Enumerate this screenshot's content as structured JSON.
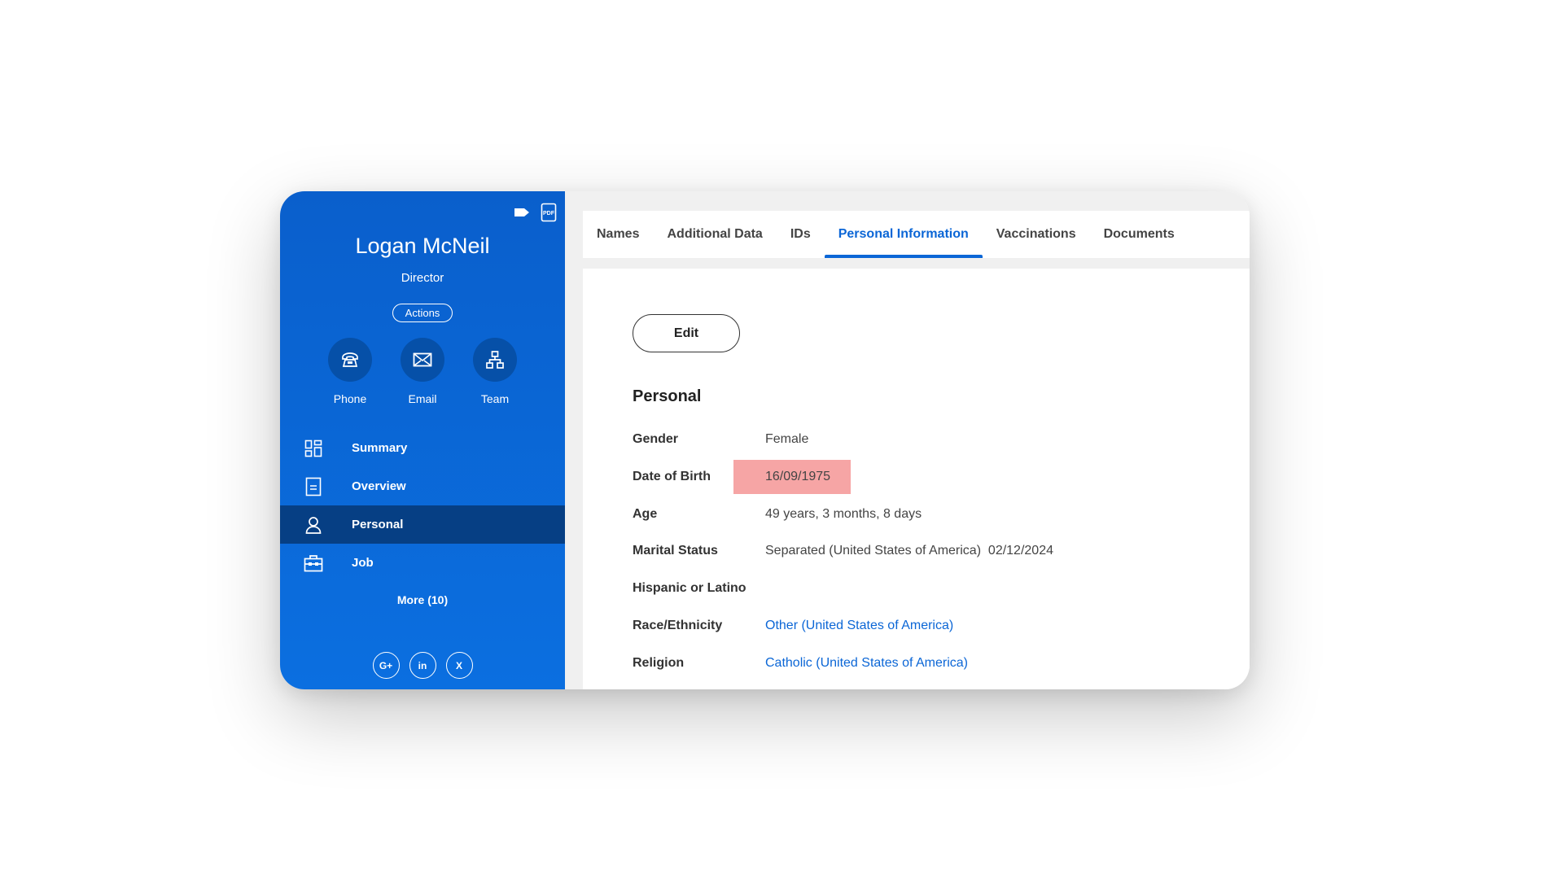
{
  "profile": {
    "name": "Logan McNeil",
    "title": "Director",
    "actions_label": "Actions"
  },
  "contacts": [
    {
      "label": "Phone",
      "icon": "phone-icon"
    },
    {
      "label": "Email",
      "icon": "email-icon"
    },
    {
      "label": "Team",
      "icon": "team-icon"
    }
  ],
  "nav": {
    "items": [
      {
        "label": "Summary",
        "icon": "dashboard-icon"
      },
      {
        "label": "Overview",
        "icon": "document-icon"
      },
      {
        "label": "Personal",
        "icon": "person-icon",
        "active": true
      },
      {
        "label": "Job",
        "icon": "briefcase-icon"
      }
    ],
    "more_label": "More (10)"
  },
  "social": {
    "google": "G+",
    "linkedin": "in",
    "x": "X"
  },
  "tabs": [
    {
      "label": "Names"
    },
    {
      "label": "Additional Data"
    },
    {
      "label": "IDs"
    },
    {
      "label": "Personal Information",
      "active": true
    },
    {
      "label": "Vaccinations"
    },
    {
      "label": "Documents"
    }
  ],
  "main": {
    "edit_label": "Edit",
    "section_title": "Personal",
    "fields": [
      {
        "label": "Gender",
        "value": "Female"
      },
      {
        "label": "Date of Birth",
        "value": "16/09/1975",
        "highlighted": true
      },
      {
        "label": "Age",
        "value": "49 years, 3 months, 8 days"
      },
      {
        "label": "Marital Status",
        "value": "Separated (United States of America)  02/12/2024"
      },
      {
        "label": "Hispanic or Latino",
        "value": ""
      },
      {
        "label": "Race/Ethnicity",
        "value": "Other (United States of America)",
        "link": true
      },
      {
        "label": "Religion",
        "value": "Catholic (United States of America)",
        "link": true
      }
    ]
  },
  "colors": {
    "sidebar": "#0b6fe0",
    "sidebar_active": "#063f84",
    "accent": "#0b66d6",
    "highlight": "#f5a0a0"
  }
}
